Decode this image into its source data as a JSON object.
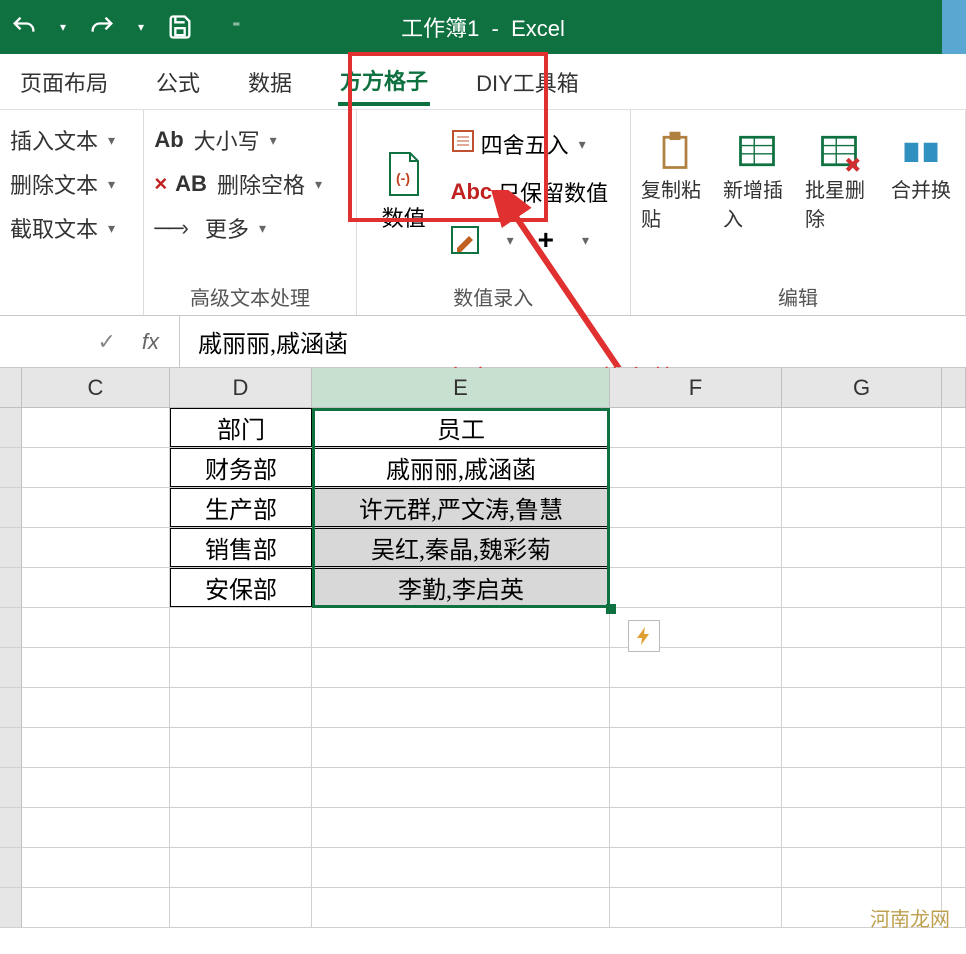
{
  "title": {
    "workbook": "工作簿1",
    "app": "Excel"
  },
  "tabs": {
    "layout": "页面布局",
    "formula": "公式",
    "data": "数据",
    "fangfang": "方方格子",
    "diy": "DIY工具箱"
  },
  "ribbon": {
    "text_group": {
      "insert": "插入文本",
      "delete": "删除文本",
      "extract": "截取文本",
      "case": "大小写",
      "delspace": "删除空格",
      "more": "更多",
      "ab": "Ab",
      "xab": "AB",
      "label": "高级文本处理"
    },
    "num_group": {
      "btn": "数值",
      "round": "四舍五入",
      "keepnum": "只保留数值",
      "abc": "Abc",
      "plus": "+",
      "label": "数值录入"
    },
    "edit_group": {
      "copy": "复制粘贴",
      "insert": "新增插入",
      "batchdel": "批星删除",
      "merge": "合并换",
      "label": "编辑"
    }
  },
  "formula_bar": {
    "check": "✓",
    "fx": "fx",
    "value": "戚丽丽,戚涵菡"
  },
  "annotation": "百度它，即可下载安装",
  "columns": {
    "c": "C",
    "d": "D",
    "e": "E",
    "f": "F",
    "g": "G"
  },
  "table": {
    "h_dept": "部门",
    "h_emp": "员工",
    "rows": [
      {
        "dept": "财务部",
        "emp": "戚丽丽,戚涵菡"
      },
      {
        "dept": "生产部",
        "emp": "许元群,严文涛,鲁慧"
      },
      {
        "dept": "销售部",
        "emp": "吴红,秦晶,魏彩菊"
      },
      {
        "dept": "安保部",
        "emp": "李勤,李启英"
      }
    ]
  },
  "watermark": "河南龙网"
}
